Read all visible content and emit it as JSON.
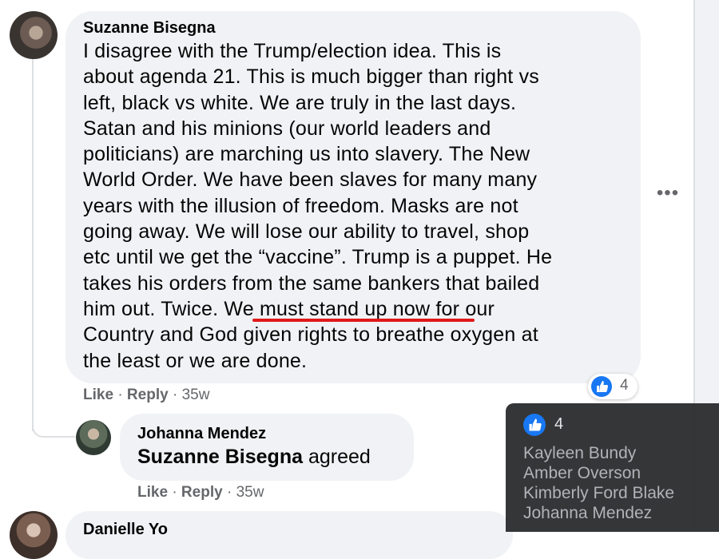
{
  "main_comment": {
    "author": "Suzanne Bisegna",
    "body_lines": [
      "I disagree with the Trump/election idea. This is",
      "about agenda 21. This is much bigger than right vs",
      "left, black vs white. We are truly in the last days.",
      "Satan and his minions (our world leaders and",
      "politicians) are marching us into slavery. The New",
      "World Order. We have been slaves for many many",
      "years with the illusion of freedom. Masks are not",
      "going away. We will lose our ability to travel, shop",
      "etc until we get the “vaccine”. Trump is a puppet. He",
      "takes his orders from the same bankers that bailed",
      "him out. Twice. We must stand up now for our",
      "Country and God given rights to breathe oxygen at",
      "the least or we are done."
    ],
    "highlighted_phrase": "We must stand up now",
    "highlight_color": "#e0191a",
    "reaction_count": "4",
    "like_label": "Like",
    "reply_label": "Reply",
    "separator": "·",
    "time": "35w",
    "more_icon": "more-horizontal-icon"
  },
  "reply": {
    "author": "Johanna Mendez",
    "mention": "Suzanne Bisegna",
    "text": " agreed",
    "like_label": "Like",
    "reply_label": "Reply",
    "time": "35w"
  },
  "next_comment": {
    "author": "Danielle Yo"
  },
  "reactions_tooltip": {
    "count": "4",
    "names": [
      "Kayleen Bundy",
      "Amber Overson",
      "Kimberly Ford Blake",
      "Johanna Mendez"
    ]
  },
  "colors": {
    "bubble_bg": "#f0f2f5",
    "like_blue": "#1877f2",
    "meta_gray": "#65676b",
    "tooltip_bg": "#28292b"
  }
}
